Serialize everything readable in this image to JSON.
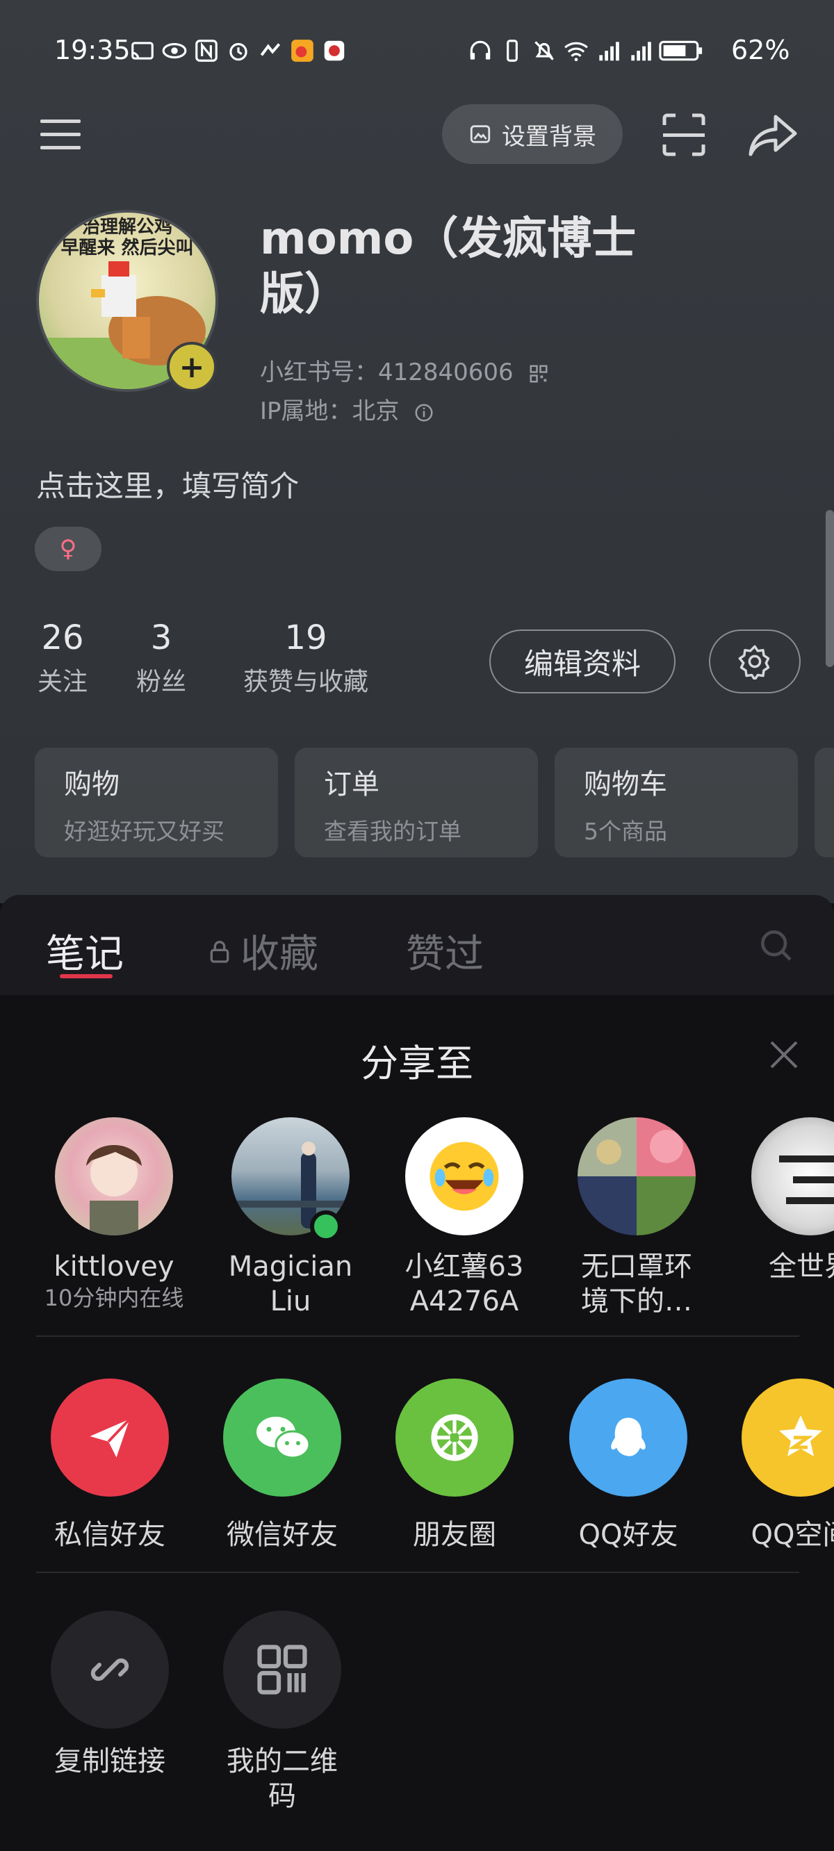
{
  "status_bar": {
    "time": "19:35",
    "battery": "62%"
  },
  "top_nav": {
    "set_background": "设置背景"
  },
  "profile": {
    "avatar_text": "治理解公鸡\n早醒来 然后尖叫",
    "username": "momo（发疯博士版）",
    "id_label": "小红书号：412840606",
    "ip_label": "IP属地：北京",
    "bio": "点击这里，填写简介",
    "gender": "♀"
  },
  "stats": [
    {
      "num": "26",
      "label": "关注"
    },
    {
      "num": "3",
      "label": "粉丝"
    },
    {
      "num": "19",
      "label": "获赞与收藏"
    }
  ],
  "buttons": {
    "edit_profile": "编辑资料"
  },
  "cards": [
    {
      "title": "购物",
      "sub": "好逛好玩又好买"
    },
    {
      "title": "订单",
      "sub": "查看我的订单"
    },
    {
      "title": "购物车",
      "sub": "5个商品"
    }
  ],
  "tabs": [
    {
      "label": "笔记"
    },
    {
      "label": "收藏"
    },
    {
      "label": "赞过"
    }
  ],
  "share": {
    "title": "分享至",
    "contacts": [
      {
        "name": "kittlovey",
        "status": "10分钟内在线"
      },
      {
        "name": "Magician\nLiu",
        "status": ""
      },
      {
        "name": "小红薯63\nA4276A",
        "status": ""
      },
      {
        "name": "无口罩环\n境下的…",
        "status": ""
      },
      {
        "name": "全世界",
        "status": ""
      }
    ],
    "apps": [
      {
        "label": "私信好友",
        "color": "#e8394b",
        "icon": "paper-plane-icon"
      },
      {
        "label": "微信好友",
        "color": "#4bbf5b",
        "icon": "wechat-icon"
      },
      {
        "label": "朋友圈",
        "color": "#6ac13f",
        "icon": "moments-icon"
      },
      {
        "label": "QQ好友",
        "color": "#4ba7ef",
        "icon": "qq-icon"
      },
      {
        "label": "QQ空间",
        "color": "#f5c52b",
        "icon": "qzone-icon"
      }
    ],
    "tools": [
      {
        "label": "复制链接",
        "icon": "link-icon"
      },
      {
        "label": "我的二维\n码",
        "icon": "qrcode-icon"
      }
    ]
  }
}
